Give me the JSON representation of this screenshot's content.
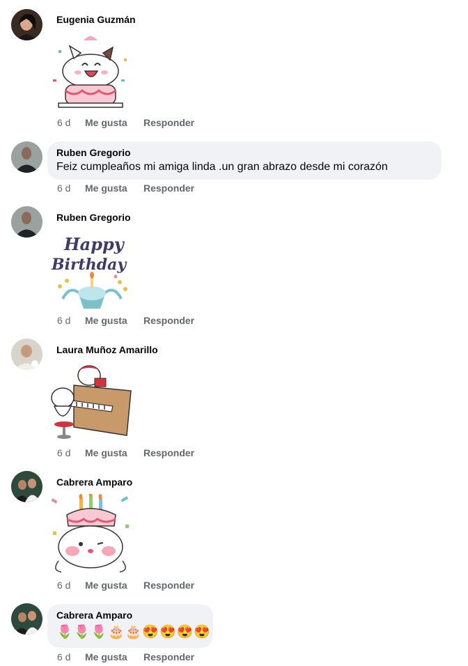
{
  "comments": [
    {
      "author": "Eugenia Guzmán",
      "time": "6 d",
      "like": "Me gusta",
      "reply": "Responder",
      "sticker": "cat-cake-sticker"
    },
    {
      "author": "Ruben Gregorio",
      "text": "Feiz cumpleaños mi amiga linda .un gran abrazo desde mi corazón",
      "time": "6 d",
      "like": "Me gusta",
      "reply": "Responder"
    },
    {
      "author": "Ruben Gregorio",
      "time": "6 d",
      "like": "Me gusta",
      "reply": "Responder",
      "sticker": "happy-birthday-sticker",
      "sticker_text_1": "Happy",
      "sticker_text_2": "Birthday"
    },
    {
      "author": "Laura Muñoz Amarillo",
      "time": "6 d",
      "like": "Me gusta",
      "reply": "Responder",
      "sticker": "piano-sticker"
    },
    {
      "author": "Cabrera Amparo",
      "time": "6 d",
      "like": "Me gusta",
      "reply": "Responder",
      "sticker": "cake-character-sticker"
    },
    {
      "author": "Cabrera Amparo",
      "text": "🌷🌷🌷🎂🎂😍😍😍😍",
      "time": "6 d",
      "like": "Me gusta",
      "reply": "Responder"
    }
  ],
  "colors": {
    "bubble": "#f0f2f5",
    "meta": "#65676b",
    "text": "#050505"
  }
}
